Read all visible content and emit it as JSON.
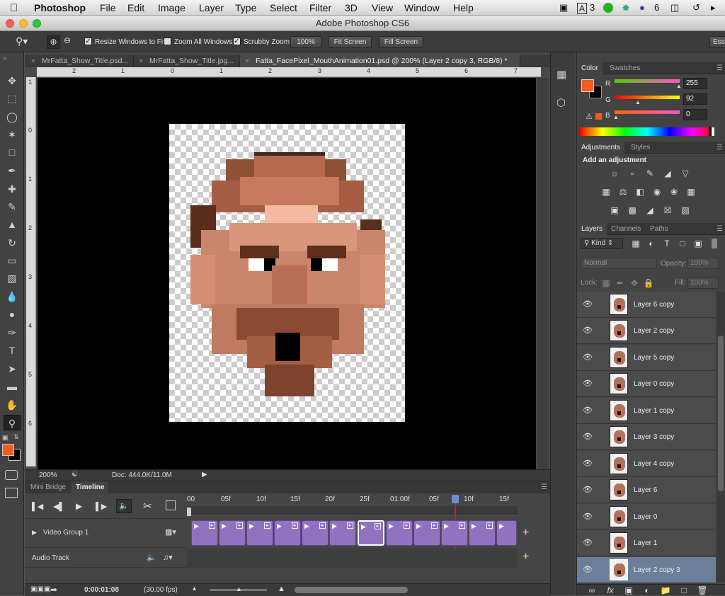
{
  "menubar": {
    "app": "Photoshop",
    "items": [
      "File",
      "Edit",
      "Image",
      "Layer",
      "Type",
      "Select",
      "Filter",
      "3D",
      "View",
      "Window",
      "Help"
    ],
    "status_num1": "3",
    "status_num2": "6"
  },
  "window": {
    "title": "Adobe Photoshop CS6"
  },
  "options": {
    "resize_windows": "Resize Windows to Fit",
    "zoom_all": "Zoom All Windows",
    "scrubby_zoom": "Scrubby Zoom",
    "zoom_btn": "100%",
    "fit_screen": "Fit Screen",
    "fill_screen": "Fill Screen",
    "ess": "Ess"
  },
  "tabs": [
    {
      "label": "MrFatta_Show_Title.psd..."
    },
    {
      "label": "MrFatta_Show_Title.jpg..."
    },
    {
      "label": "Fatta_FacePixel_MouthAnimation01.psd @ 200% (Layer 2 copy 3, RGB/8) *"
    }
  ],
  "rulers": {
    "h": [
      "2",
      "1",
      "0",
      "1",
      "2",
      "3",
      "4",
      "5",
      "6",
      "7"
    ],
    "v": [
      "1",
      "0",
      "1",
      "2",
      "3",
      "4",
      "5",
      "6"
    ]
  },
  "status": {
    "zoom": "200%",
    "doc": "Doc: 444.0K/11.0M"
  },
  "color_panel": {
    "tabs": [
      "Color",
      "Swatches"
    ],
    "r_label": "R",
    "g_label": "G",
    "b_label": "B",
    "r": "255",
    "g": "92",
    "b": "0",
    "foreground": "#f25c1f"
  },
  "adjustments": {
    "tabs": [
      "Adjustments",
      "Styles"
    ],
    "heading": "Add an adjustment"
  },
  "layers_panel": {
    "tabs": [
      "Layers",
      "Channels",
      "Paths"
    ],
    "kind": "Kind",
    "blend": "Normal",
    "opacity_label": "Opacity:",
    "opacity": "100%",
    "lock_label": "Lock:",
    "fill_label": "Fill:",
    "fill": "100%",
    "layers": [
      {
        "name": "Layer 6 copy"
      },
      {
        "name": "Layer 2 copy"
      },
      {
        "name": "Layer 5 copy"
      },
      {
        "name": "Layer 0 copy"
      },
      {
        "name": "Layer 1 copy"
      },
      {
        "name": "Layer 3 copy"
      },
      {
        "name": "Layer 4 copy"
      },
      {
        "name": "Layer 6"
      },
      {
        "name": "Layer 0"
      },
      {
        "name": "Layer 1"
      },
      {
        "name": "Layer 2 copy 3"
      }
    ],
    "selected_index": 10
  },
  "timeline": {
    "tabs": [
      "Mini Bridge",
      "Timeline"
    ],
    "ticks": [
      "00",
      "05f",
      "10f",
      "15f",
      "20f",
      "25f",
      "01:00f",
      "05f",
      "10f",
      "15f"
    ],
    "video_group": "Video Group 1",
    "audio_track": "Audio Track",
    "timecode": "0:00:01:08",
    "fps": "(30.00 fps)"
  }
}
